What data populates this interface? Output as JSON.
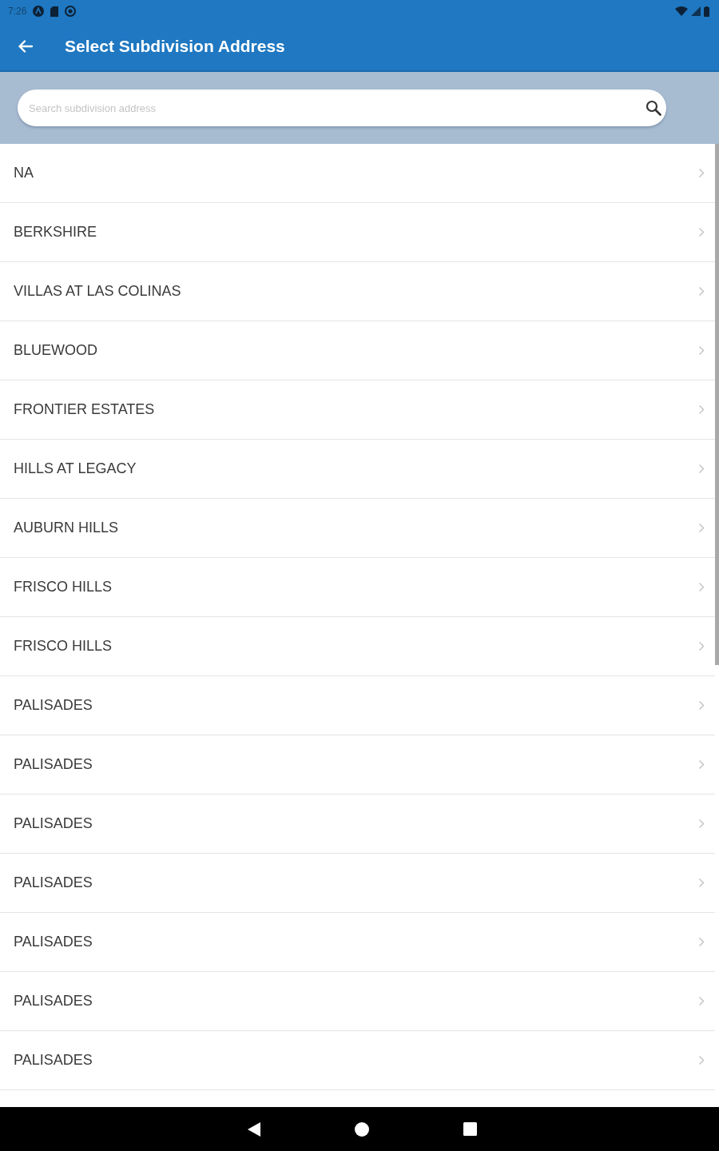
{
  "status_bar": {
    "time": "7:26"
  },
  "app_bar": {
    "title": "Select Subdivision Address"
  },
  "search": {
    "placeholder": "Search subdivision address"
  },
  "subdivisions": [
    "NA",
    "BERKSHIRE",
    "VILLAS AT LAS COLINAS",
    "BLUEWOOD",
    "FRONTIER ESTATES",
    "HILLS AT LEGACY",
    "AUBURN HILLS",
    "FRISCO HILLS",
    "FRISCO HILLS",
    "PALISADES",
    "PALISADES",
    "PALISADES",
    "PALISADES",
    "PALISADES",
    "PALISADES",
    "PALISADES"
  ]
}
